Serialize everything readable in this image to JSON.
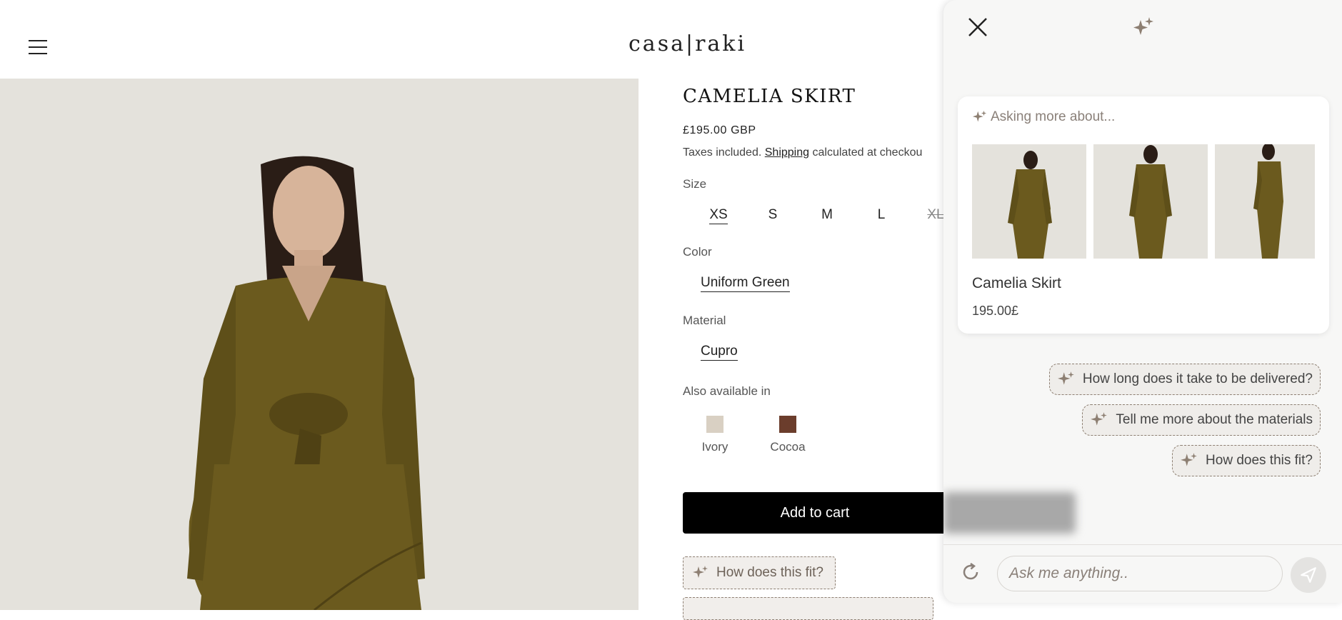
{
  "header": {
    "logo": "casa|raki"
  },
  "product": {
    "title": "CAMELIA SKIRT",
    "price": "£195.00 GBP",
    "tax_prefix": "Taxes included.",
    "tax_link": "Shipping",
    "tax_suffix": "calculated at checkou",
    "size_label": "Size",
    "sizes": [
      {
        "label": "XS",
        "state": "selected"
      },
      {
        "label": "S",
        "state": "available"
      },
      {
        "label": "M",
        "state": "available"
      },
      {
        "label": "L",
        "state": "available"
      },
      {
        "label": "XL",
        "state": "unavailable"
      }
    ],
    "color_label": "Color",
    "color_value": "Uniform Green",
    "material_label": "Material",
    "material_value": "Cupro",
    "also_label": "Also available in",
    "also": [
      {
        "label": "Ivory",
        "color": "#d9d0c3"
      },
      {
        "label": "Cocoa",
        "color": "#6b3d2c"
      }
    ],
    "add_to_cart": "Add to cart",
    "suggestion_chip": "How does this fit?"
  },
  "assistant": {
    "asking_label": "Asking more about...",
    "card": {
      "name": "Camelia Skirt",
      "price": "195.00£"
    },
    "suggestions": [
      "How long does it take to be delivered?",
      "Tell me more about the materials",
      "How does this fit?"
    ],
    "input_placeholder": "Ask me anything..",
    "icons": [
      "close-icon",
      "sparkle-icon",
      "refresh-icon",
      "send-icon"
    ]
  },
  "colors": {
    "accent_brown": "#8d7f72",
    "chip_bg": "#efedea",
    "garment_olive": "#6b5a1e"
  }
}
